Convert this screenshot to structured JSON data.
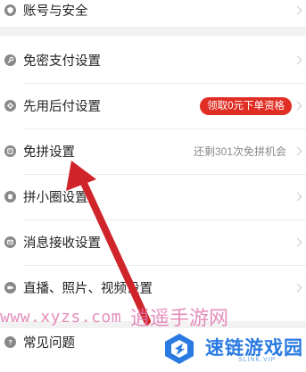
{
  "settings": {
    "account": {
      "label": "账号与安全",
      "icon": "shield-icon"
    },
    "no_password_pay": {
      "label": "免密支付设置",
      "icon": "key-icon"
    },
    "pay_later": {
      "label": "先用后付设置",
      "icon": "gear-icon",
      "badge": "领取0元下单资格",
      "badge_color": "#e02e24"
    },
    "free_group": {
      "label": "免拼设置",
      "icon": "ticket-icon",
      "hint": "还剩301次免拼机会"
    },
    "circle": {
      "label": "拼小圈设置",
      "icon": "circle-icon"
    },
    "messages": {
      "label": "消息接收设置",
      "icon": "message-icon"
    },
    "media": {
      "label": "直播、照片、视频设置",
      "icon": "camera-icon"
    },
    "faq": {
      "label": "常见问题",
      "icon": "question-icon"
    }
  },
  "watermark": {
    "url": "www.xyzs.com",
    "text": "逍遥手游网",
    "color": "#e07bb0"
  },
  "logo": {
    "name": "速链游戏园",
    "sub": "SLINK.VIP",
    "color": "#2a7ae2"
  },
  "arrow_color": "#d0242b"
}
